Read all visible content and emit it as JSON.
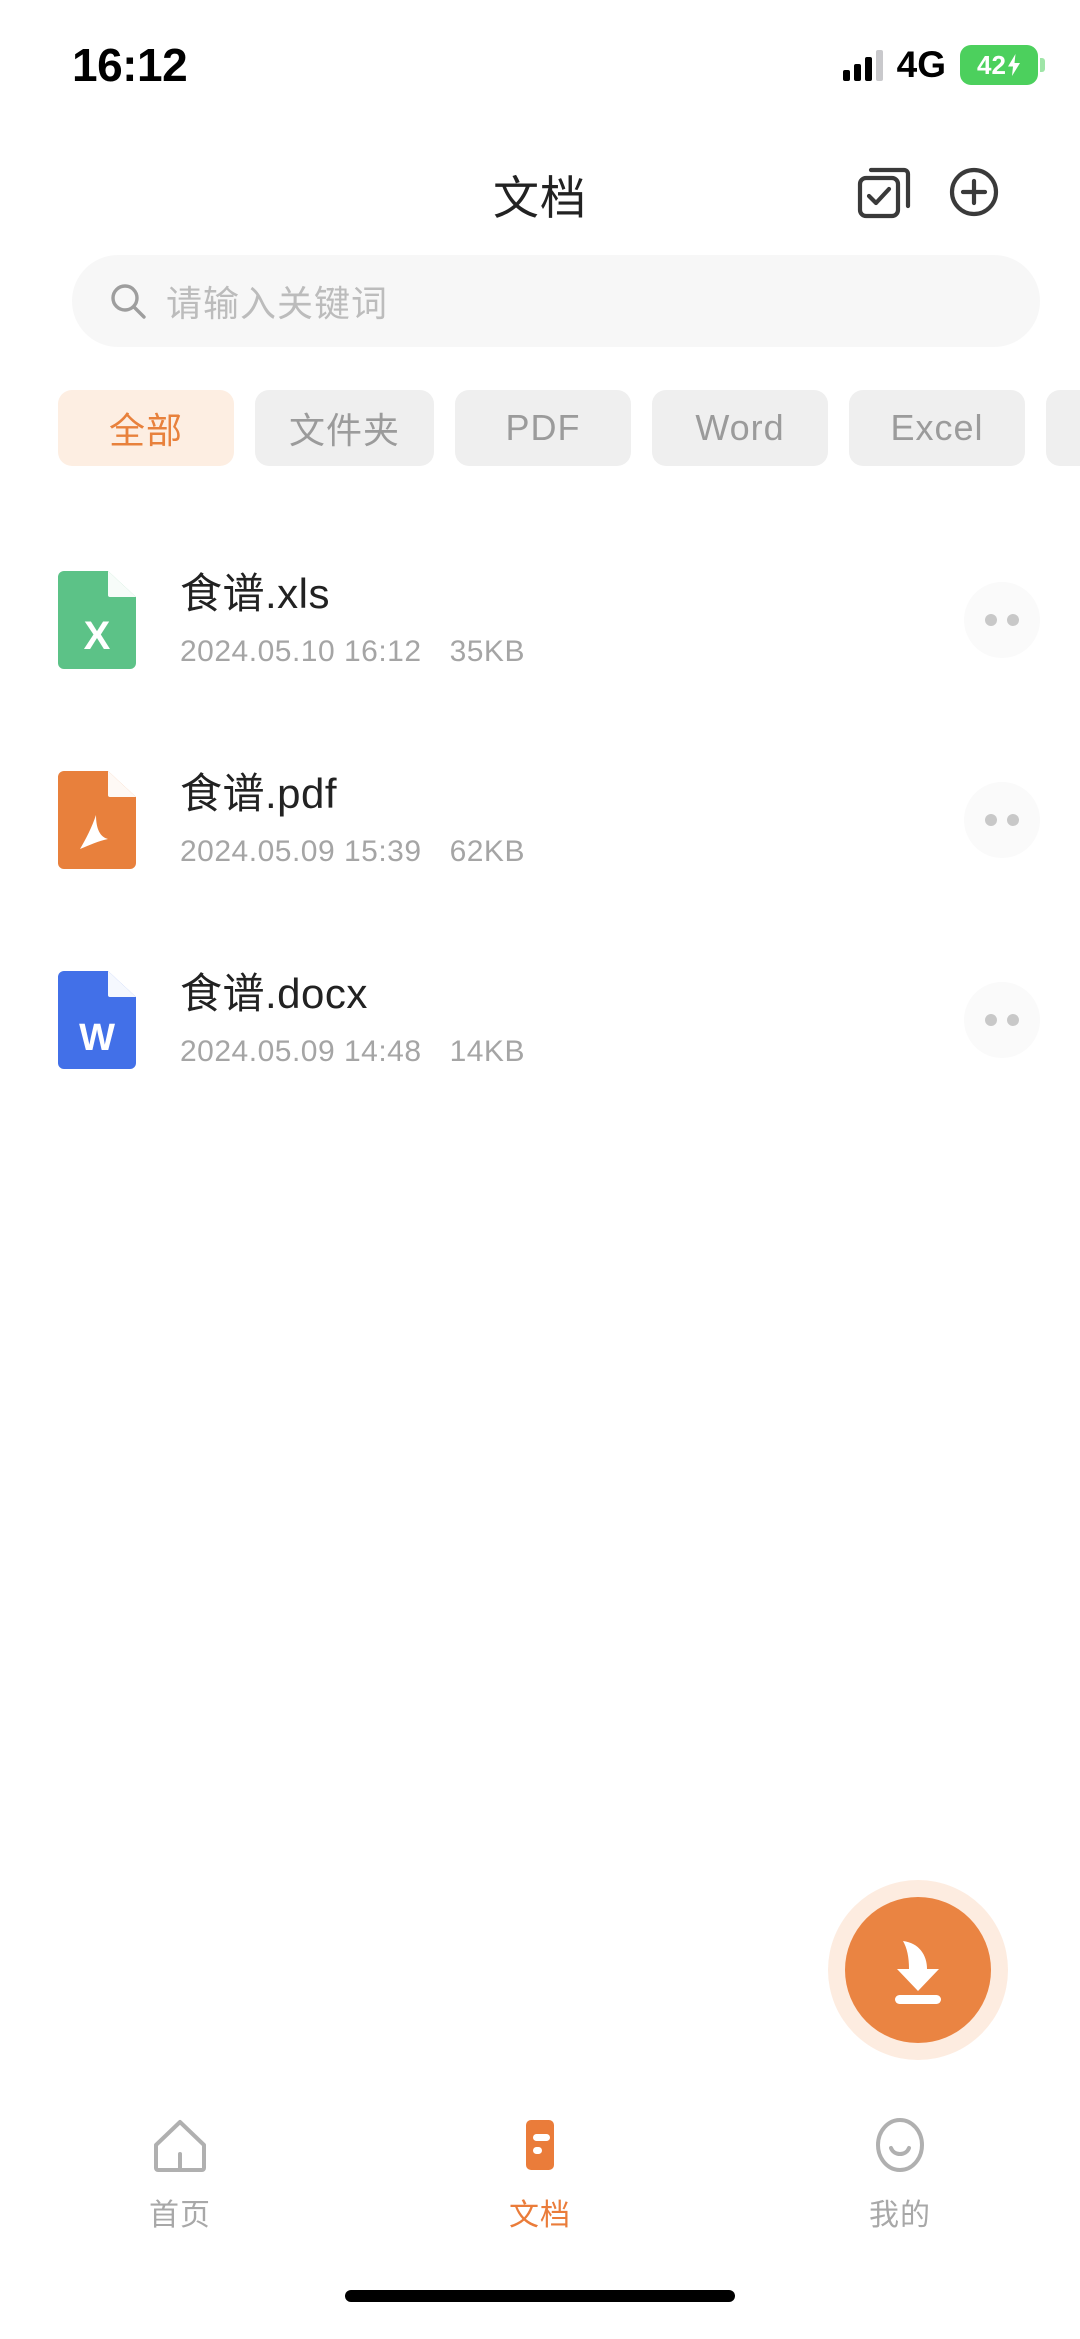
{
  "status_bar": {
    "time": "16:12",
    "network": "4G",
    "battery_percent": "42",
    "signal_icon": "signal-bars-icon",
    "battery_icon": "battery-charging-icon"
  },
  "header": {
    "title": "文档",
    "select_icon": "multi-select-icon",
    "add_icon": "plus-circle-icon"
  },
  "search": {
    "placeholder": "请输入关键词",
    "value": "",
    "icon": "search-icon"
  },
  "filters": {
    "chips": [
      {
        "label": "全部",
        "active": true
      },
      {
        "label": "文件夹",
        "active": false
      },
      {
        "label": "PDF",
        "active": false
      },
      {
        "label": "Word",
        "active": false
      },
      {
        "label": "Excel",
        "active": false
      },
      {
        "label": "",
        "active": false
      }
    ]
  },
  "files": [
    {
      "name": "食谱.xls",
      "date": "2024.05.10 16:12",
      "size": "35KB",
      "type": "xls",
      "icon": "excel-file-icon",
      "icon_color": "#5cc287",
      "icon_letter": "X",
      "more_icon": "more-dots-icon"
    },
    {
      "name": "食谱.pdf",
      "date": "2024.05.09 15:39",
      "size": "62KB",
      "type": "pdf",
      "icon": "pdf-file-icon",
      "icon_color": "#e8803c",
      "icon_letter": "A",
      "more_icon": "more-dots-icon"
    },
    {
      "name": "食谱.docx",
      "date": "2024.05.09 14:48",
      "size": "14KB",
      "type": "docx",
      "icon": "word-file-icon",
      "icon_color": "#4270e8",
      "icon_letter": "W",
      "more_icon": "more-dots-icon"
    }
  ],
  "fab": {
    "icon": "download-icon",
    "color": "#ea8442",
    "halo_color": "#fdece0"
  },
  "tabbar": {
    "items": [
      {
        "label": "首页",
        "icon": "home-icon",
        "active": false
      },
      {
        "label": "文档",
        "icon": "document-icon",
        "active": true
      },
      {
        "label": "我的",
        "icon": "profile-smiley-icon",
        "active": false
      }
    ],
    "active_color": "#ea7c3a",
    "inactive_color": "#a8a8a8"
  },
  "theme": {
    "accent": "#ea7c3a",
    "accent_soft": "#fdeee2",
    "chip_bg": "#efefef",
    "search_bg": "#f7f7f7"
  }
}
